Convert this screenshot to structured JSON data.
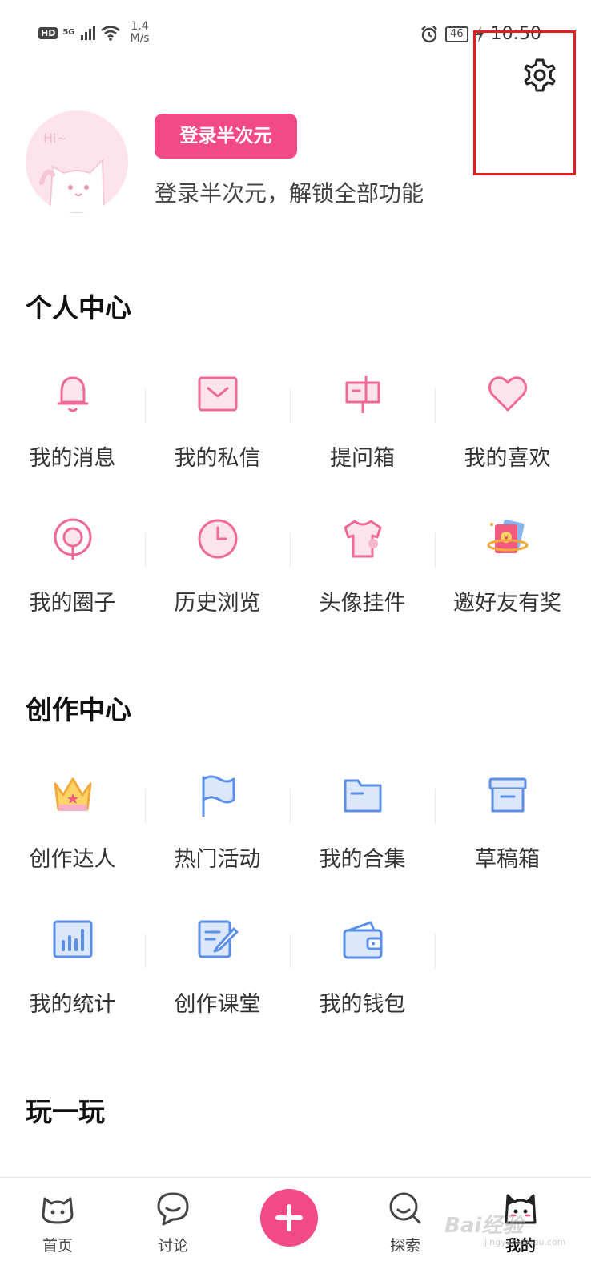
{
  "status_bar": {
    "hd": "HD",
    "network": "5G",
    "speed_value": "1.4",
    "speed_unit": "M/s",
    "battery": "46",
    "time": "10:50"
  },
  "profile": {
    "login_button": "登录半次元",
    "subtitle": "登录半次元，解锁全部功能"
  },
  "sections": {
    "personal_center": {
      "title": "个人中心",
      "items": [
        {
          "label": "我的消息",
          "icon": "bell-icon"
        },
        {
          "label": "我的私信",
          "icon": "envelope-icon"
        },
        {
          "label": "提问箱",
          "icon": "mailbox-icon"
        },
        {
          "label": "我的喜欢",
          "icon": "heart-icon"
        },
        {
          "label": "我的圈子",
          "icon": "circle-location-icon"
        },
        {
          "label": "历史浏览",
          "icon": "clock-icon"
        },
        {
          "label": "头像挂件",
          "icon": "tshirt-icon"
        },
        {
          "label": "邀好友有奖",
          "icon": "gift-envelope-icon"
        }
      ]
    },
    "creation_center": {
      "title": "创作中心",
      "items": [
        {
          "label": "创作达人",
          "icon": "crown-icon"
        },
        {
          "label": "热门活动",
          "icon": "flag-icon"
        },
        {
          "label": "我的合集",
          "icon": "folder-icon"
        },
        {
          "label": "草稿箱",
          "icon": "archive-box-icon"
        },
        {
          "label": "我的统计",
          "icon": "bar-chart-icon"
        },
        {
          "label": "创作课堂",
          "icon": "edit-document-icon"
        },
        {
          "label": "我的钱包",
          "icon": "wallet-icon"
        }
      ]
    },
    "play": {
      "title": "玩一玩"
    }
  },
  "tabbar": {
    "home": "首页",
    "discuss": "讨论",
    "explore": "探索",
    "mine": "我的"
  },
  "watermark": {
    "main": "Bai经验",
    "sub": "jingyan.baidu.com"
  },
  "colors": {
    "accent_pink": "#f24a86",
    "icon_blue": "#5b8ee6",
    "highlight_red": "#e02020"
  }
}
